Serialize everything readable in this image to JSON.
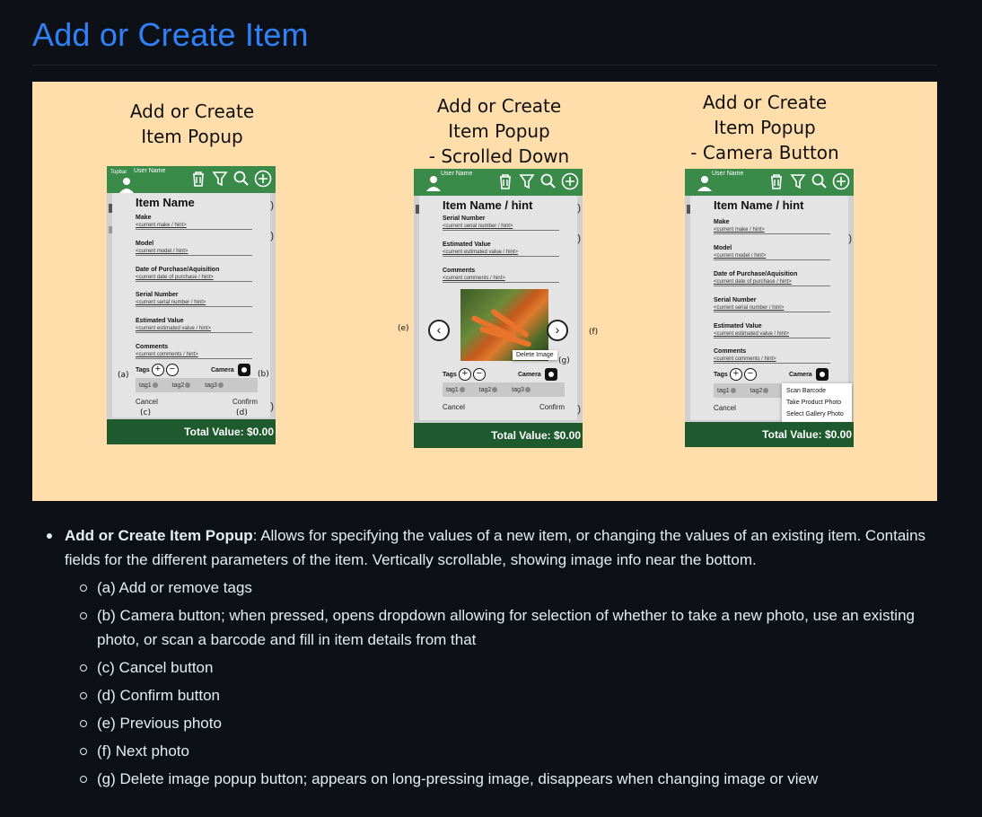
{
  "page": {
    "title": "Add or Create Item"
  },
  "mockups": {
    "panel1": {
      "caption_line1": "Add or Create",
      "caption_line2": "Item Popup",
      "topbar_label": "Topbar",
      "user_name": "User Name",
      "item_title": "Item Name",
      "fields": [
        {
          "label": "Make",
          "value": "<current make / hint>"
        },
        {
          "label": "Model",
          "value": "<current model / hint>"
        },
        {
          "label": "Date of Purchase/Aquisition",
          "value": "<current date of purchase / hint>"
        },
        {
          "label": "Serial Number",
          "value": "<current serial number / hint>"
        },
        {
          "label": "Estimated Value",
          "value": "<current estimated value / hint>"
        },
        {
          "label": "Comments",
          "value": "<current comments / hint>"
        }
      ],
      "tags_label": "Tags",
      "camera_label": "Camera",
      "tags": [
        "tag1",
        "tag2",
        "tag3"
      ],
      "cancel": "Cancel",
      "confirm": "Confirm",
      "total": "Total Value: $0.00",
      "anno_a": "(a)",
      "anno_b": "(b)",
      "anno_c": "(c)",
      "anno_d": "(d)"
    },
    "panel2": {
      "caption_line1": "Add or Create",
      "caption_line2": "Item Popup",
      "caption_line3": "- Scrolled Down",
      "user_name": "User Name",
      "item_title": "Item Name / hint",
      "fields": [
        {
          "label": "Serial Number",
          "value": "<current serial number / hint>"
        },
        {
          "label": "Estimated Value",
          "value": "<current estimated value / hint>"
        },
        {
          "label": "Comments",
          "value": "<current comments / hint>"
        }
      ],
      "delete_image": "Delete Image",
      "tags_label": "Tags",
      "camera_label": "Camera",
      "tags": [
        "tag1",
        "tag2",
        "tag3"
      ],
      "cancel": "Cancel",
      "confirm": "Confirm",
      "total": "Total Value: $0.00",
      "anno_e": "(e)",
      "anno_f": "(f)",
      "anno_g": "(g)"
    },
    "panel3": {
      "caption_line1": "Add or Create",
      "caption_line2": "Item Popup",
      "caption_line3": "- Camera Button",
      "user_name": "User Name",
      "item_title": "Item Name / hint",
      "fields": [
        {
          "label": "Make",
          "value": "<current make / hint>"
        },
        {
          "label": "Model",
          "value": "<current model / hint>"
        },
        {
          "label": "Date of Purchase/Aquisition",
          "value": "<current date of purchase / hint>"
        },
        {
          "label": "Serial Number",
          "value": "<current serial number / hint>"
        },
        {
          "label": "Estimated Value",
          "value": "<current estimated value / hint>"
        },
        {
          "label": "Comments",
          "value": "<current comments / hint>"
        }
      ],
      "tags_label": "Tags",
      "camera_label": "Camera",
      "tags": [
        "tag1",
        "tag2"
      ],
      "dropdown": [
        "Scan Barcode",
        "Take Product Photo",
        "Select Gallery Photo"
      ],
      "cancel": "Cancel",
      "total": "Total Value: $0.00"
    }
  },
  "notes": {
    "main_bold": "Add or Create Item Popup",
    "main_text": ": Allows for specifying the values of a new item, or changing the values of an existing item. Contains fields for the different parameters of the item. Vertically scrollable, showing image info near the bottom.",
    "sub_items": [
      "(a) Add or remove tags",
      "(b) Camera button; when pressed, opens dropdown allowing for selection of whether to take a new photo, use an existing photo, or scan a barcode and fill in item details from that",
      "(c) Cancel button",
      "(d) Confirm button",
      "(e) Previous photo",
      "(f) Next photo",
      "(g) Delete image popup button; appears on long-pressing image, disappears when changing image or view"
    ]
  }
}
